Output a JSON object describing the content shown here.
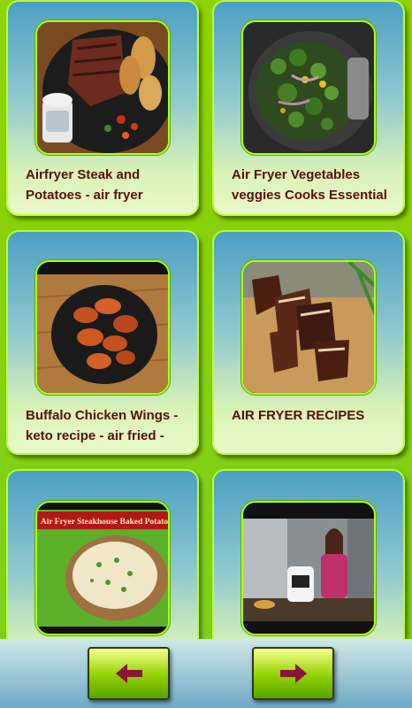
{
  "cards": [
    {
      "title": "Airfryer Steak and Potatoes - air fryer"
    },
    {
      "title": "Air Fryer Vegetables veggies Cooks Essential"
    },
    {
      "title": "Buffalo Chicken Wings - keto recipe - air fried -"
    },
    {
      "title": "AIR FRYER RECIPES"
    },
    {
      "title": ""
    },
    {
      "title": ""
    }
  ],
  "thumb5_banner": "Air Fryer Steakhouse Baked Potato",
  "nav": {
    "prev_icon": "arrow-left-icon",
    "next_icon": "arrow-right-icon"
  },
  "colors": {
    "title": "#5a0f0f",
    "arrow": "#8b1538",
    "border": "#a9ff24"
  }
}
